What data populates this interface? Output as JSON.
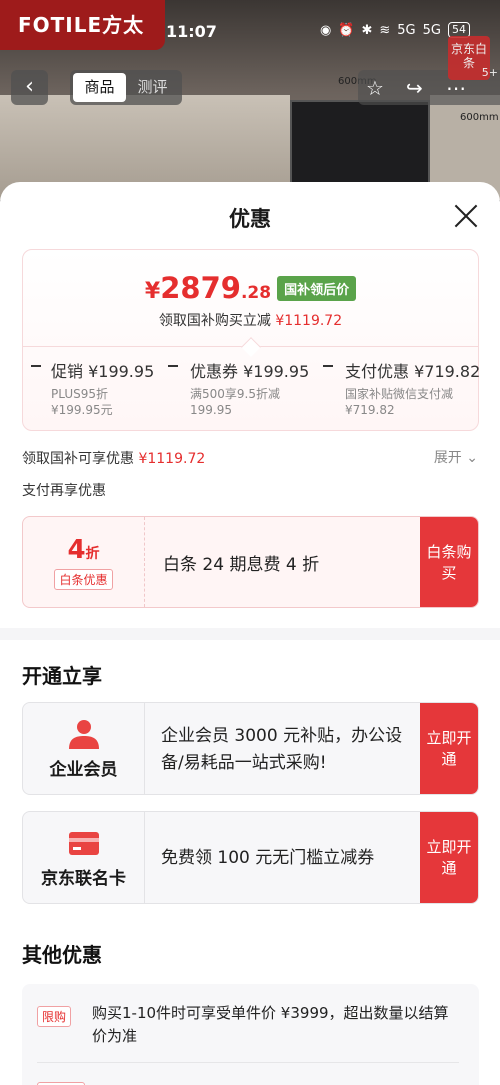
{
  "brand": {
    "logo_text": "FOTILE方太"
  },
  "status_bar": {
    "time": "11:07",
    "signal1": "5G",
    "signal2": "5G",
    "battery": "54"
  },
  "nav": {
    "tabs": [
      "商品",
      "测评"
    ],
    "active_tab": 0,
    "jd_badge": "京东白条",
    "jd_badge_sub": "5+"
  },
  "background": {
    "dim1": "600mm",
    "dim2": "600mm"
  },
  "sheet": {
    "title": "优惠"
  },
  "price_card": {
    "currency": "¥",
    "price_int": "2879",
    "price_dec": ".28",
    "tag": "国补领后价",
    "sub_text": "领取国补购买立减",
    "sub_amount": "¥1119.72",
    "terms": [
      {
        "title": "促销 ¥199.95",
        "desc1": "PLUS95折",
        "desc2": "¥199.95元"
      },
      {
        "title": "优惠券 ¥199.95",
        "desc1": "满500享9.5折减",
        "desc2": "199.95"
      },
      {
        "title": "支付优惠 ¥719.82",
        "desc1": "国家补贴微信支付减",
        "desc2": "¥719.82"
      }
    ]
  },
  "national_subsidy": {
    "label": "领取国补可享优惠",
    "amount": "¥1119.72",
    "expand": "展开"
  },
  "pay_again": {
    "label": "支付再享优惠"
  },
  "baitiao": {
    "discount": "4",
    "discount_unit": "折",
    "pill": "白条优惠",
    "desc": "白条 24 期息费 4 折",
    "button": "白条购买"
  },
  "open_section": {
    "title": "开通立享",
    "cards": [
      {
        "name": "企业会员",
        "desc": "企业会员 3000 元补贴，办公设备/易耗品一站式采购!",
        "button": "立即开通"
      },
      {
        "name": "京东联名卡",
        "desc": "免费领 100 元无门槛立减券",
        "button": "立即开通"
      }
    ]
  },
  "other_section": {
    "title": "其他优惠",
    "limit_tag": "限购",
    "limit_text": "购买1-10件时可享受单件价 ¥3999，超出数量以结算价为准"
  }
}
